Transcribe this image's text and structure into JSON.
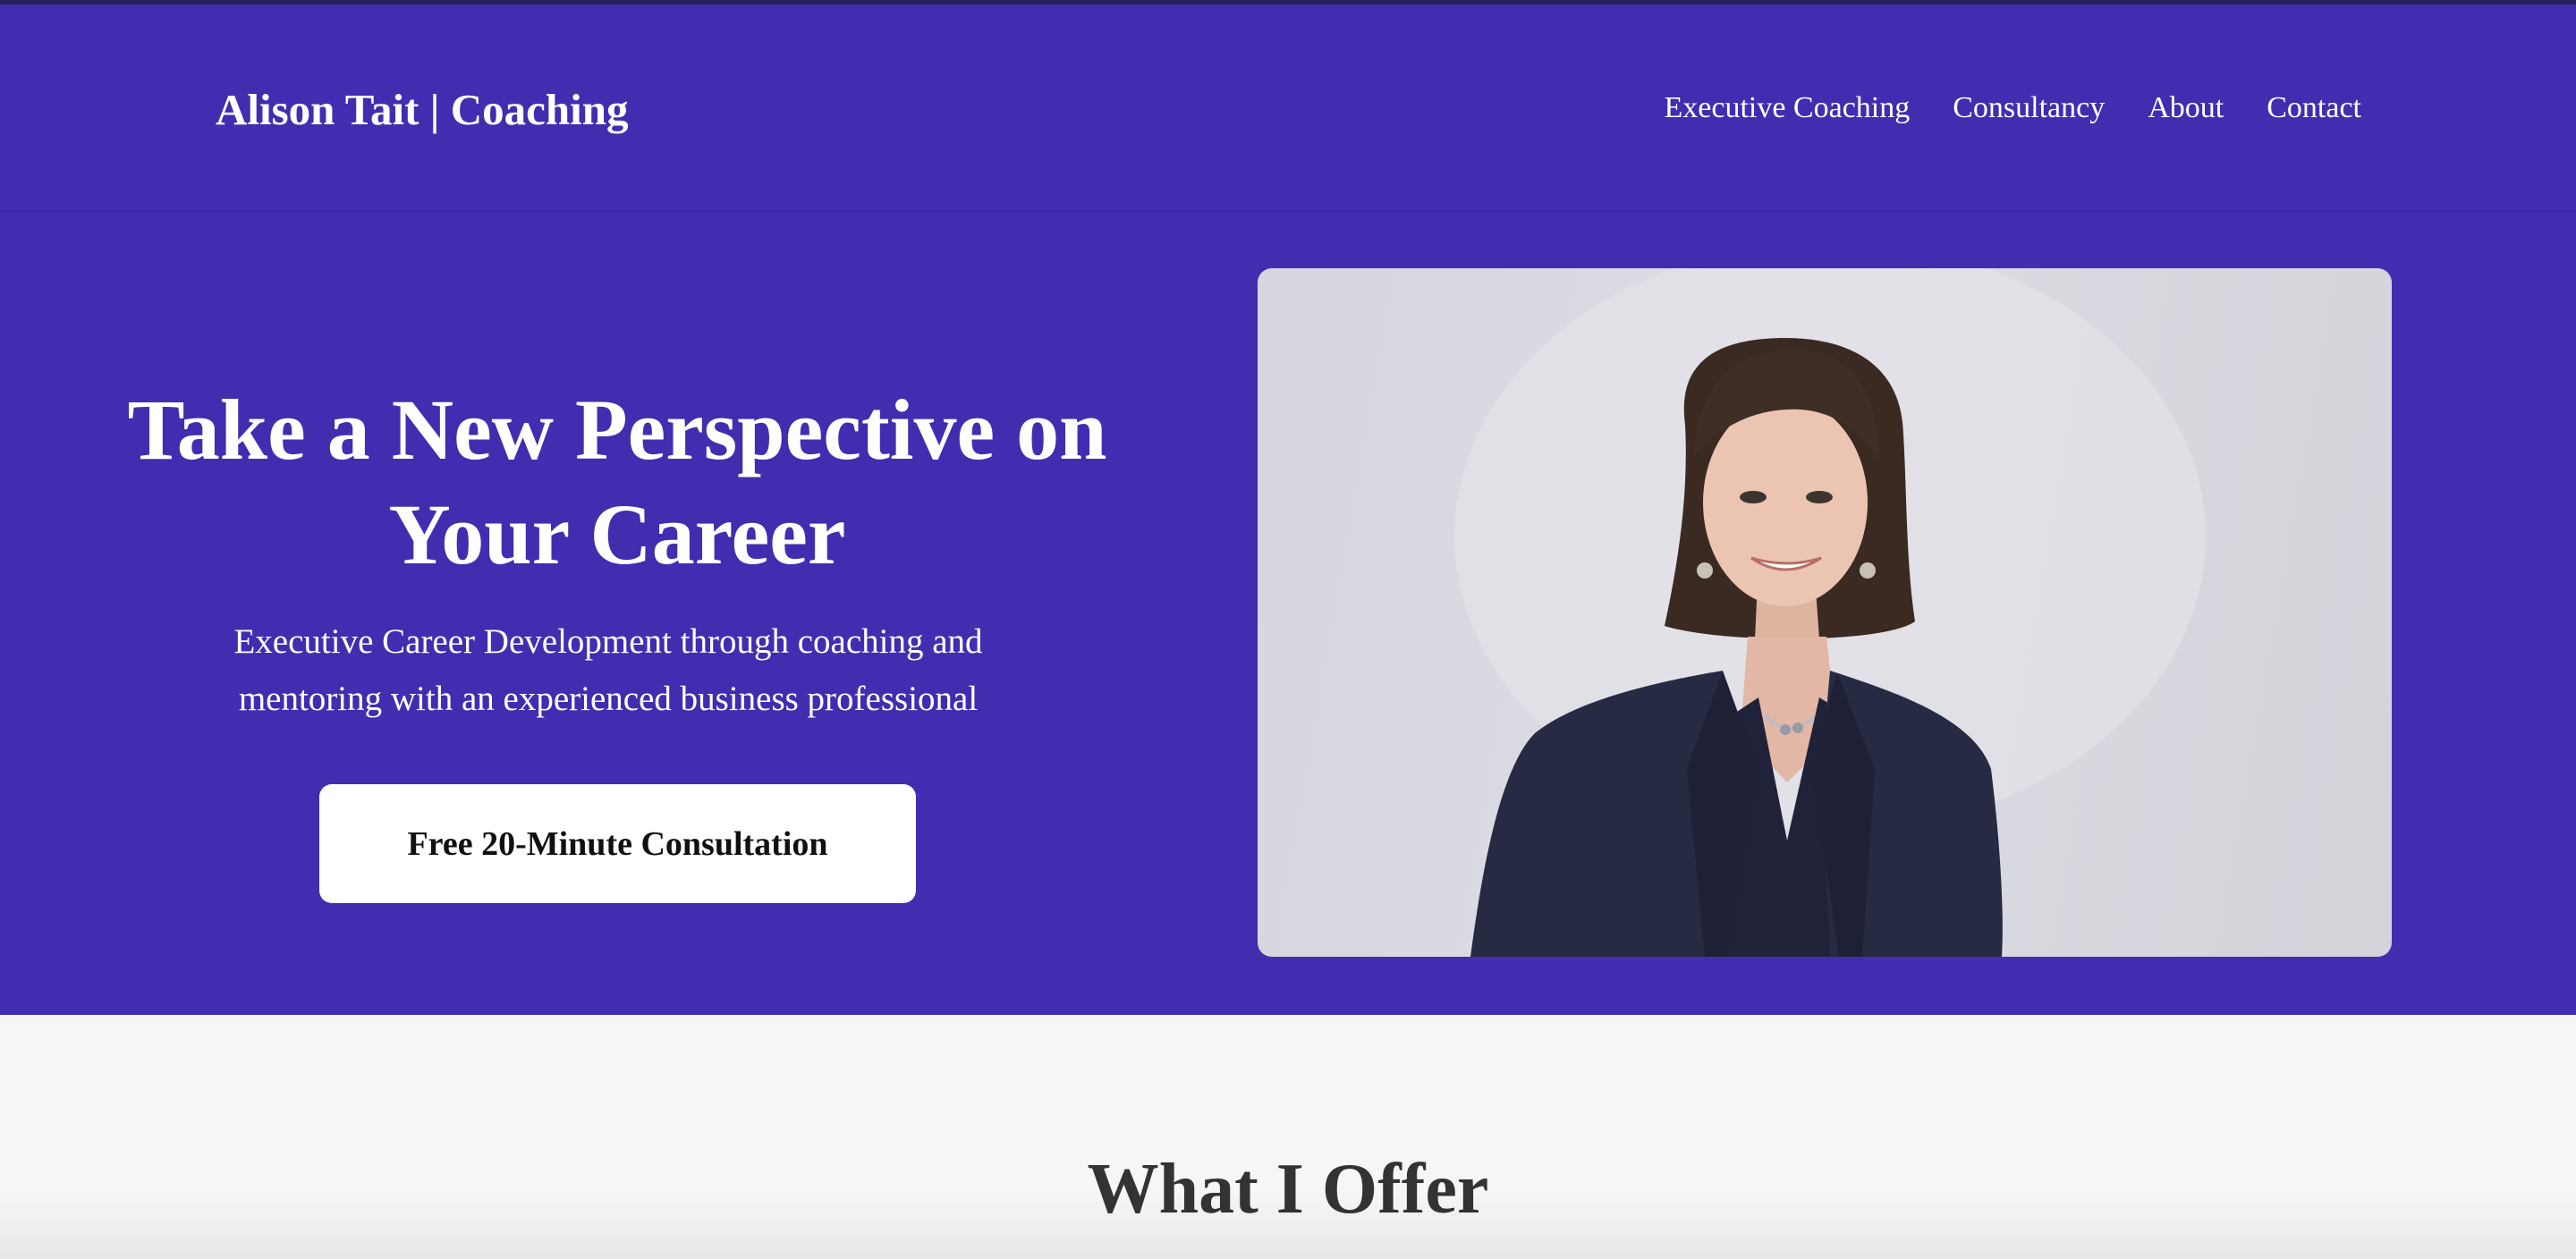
{
  "header": {
    "logo": "Alison Tait | Coaching",
    "nav": [
      {
        "label": "Executive Coaching"
      },
      {
        "label": "Consultancy"
      },
      {
        "label": "About"
      },
      {
        "label": "Contact"
      }
    ]
  },
  "hero": {
    "title": "Take a New Perspective on Your Career",
    "subtitle": "Executive Career Development through coaching and mentoring with an experienced business professional",
    "cta_label": "Free 20-Minute Consultation"
  },
  "offer": {
    "heading": "What I Offer"
  },
  "colors": {
    "hero_background": "#422db0",
    "page_background": "#f6f6f6",
    "heading_text": "#333333"
  }
}
